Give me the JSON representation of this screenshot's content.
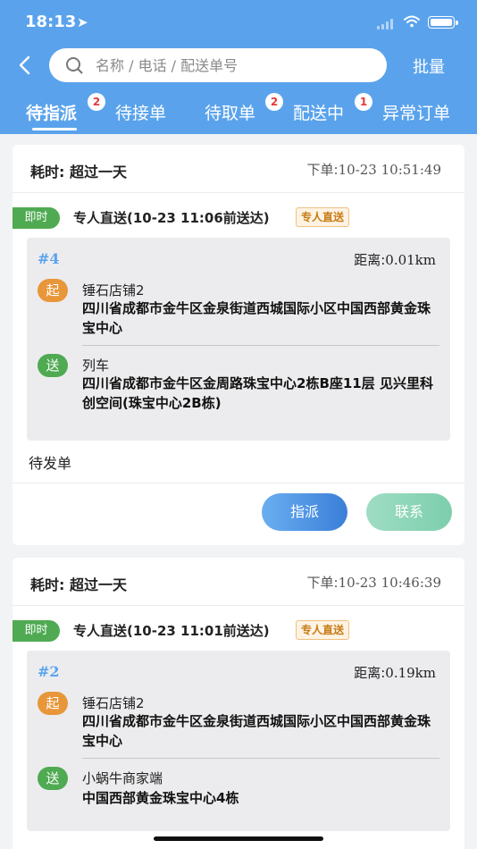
{
  "status_bar": {
    "time": "18:13"
  },
  "search": {
    "placeholder": "名称 / 电话 / 配送单号"
  },
  "header": {
    "batch_label": "批量"
  },
  "tabs": [
    {
      "label": "待指派",
      "badge": "2",
      "active": true
    },
    {
      "label": "待接单",
      "badge": ""
    },
    {
      "label": "待取单",
      "badge": "2"
    },
    {
      "label": "配送中",
      "badge": "1"
    },
    {
      "label": "异常订单",
      "badge": ""
    }
  ],
  "orders": [
    {
      "elapsed_label": "耗时:",
      "elapsed_value": "超过一天",
      "order_time_label": "下单:",
      "order_time_value": "10-23 10:51:49",
      "instant_tag": "即时",
      "delivery_type": "专人直送(10-23 11:06前送达)",
      "delivery_tag": "专人直送",
      "sequence": "#4",
      "distance_label": "距离:",
      "distance_value": "0.01km",
      "pickup_icon": "起",
      "pickup_name": "锤石店铺2",
      "pickup_address": "四川省成都市金牛区金泉街道西城国际小区中国西部黄金珠宝中心",
      "deliver_icon": "送",
      "deliver_name": "列车",
      "deliver_address": "四川省成都市金牛区金周路珠宝中心2栋B座11层 见兴里科创空间(珠宝中心2B栋)",
      "status": "待发单",
      "dispatch_label": "指派",
      "contact_label": "联系"
    },
    {
      "elapsed_label": "耗时:",
      "elapsed_value": "超过一天",
      "order_time_label": "下单:",
      "order_time_value": "10-23 10:46:39",
      "instant_tag": "即时",
      "delivery_type": "专人直送(10-23 11:01前送达)",
      "delivery_tag": "专人直送",
      "sequence": "#2",
      "distance_label": "距离:",
      "distance_value": "0.19km",
      "pickup_icon": "起",
      "pickup_name": "锤石店铺2",
      "pickup_address": "四川省成都市金牛区金泉街道西城国际小区中国西部黄金珠宝中心",
      "deliver_icon": "送",
      "deliver_name": "小蜗牛商家端",
      "deliver_address": "中国西部黄金珠宝中心4栋"
    }
  ],
  "colors": {
    "header_bg": "#5aa3ec",
    "instant_tag": "#4faa52",
    "pickup_icon": "#e8963a",
    "badge_text": "#e23b3b",
    "sequence": "#5aa3ec"
  },
  "icons": [
    "location-arrow-icon",
    "signal-icon",
    "wifi-icon",
    "battery-icon",
    "back-arrow-icon",
    "search-icon"
  ]
}
